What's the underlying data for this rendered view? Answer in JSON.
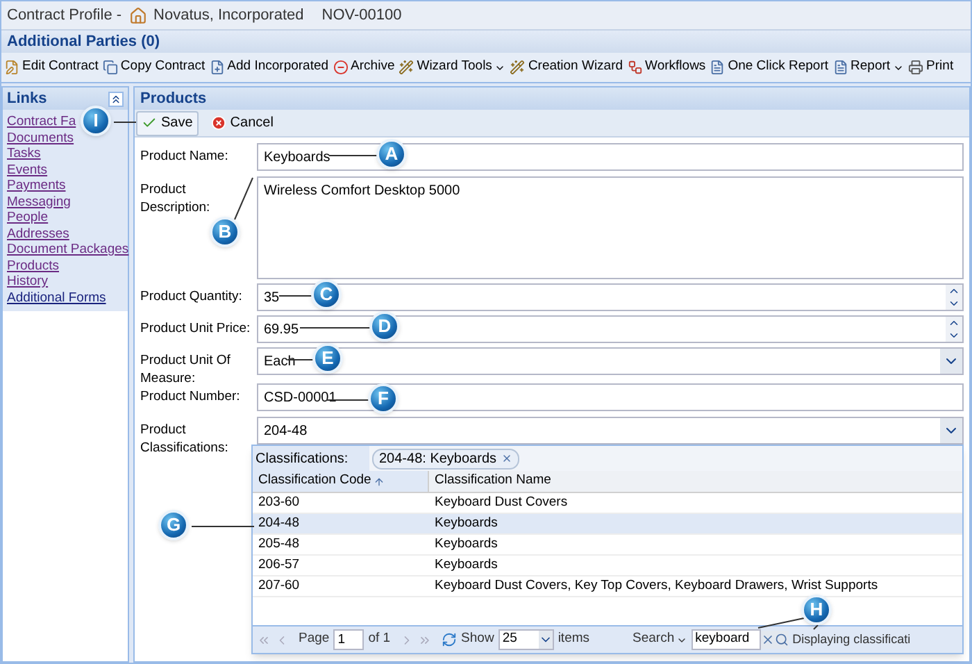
{
  "header": {
    "prefix": "Contract Profile -",
    "company": "Novatus, Incorporated",
    "contract_id": "NOV-00100"
  },
  "additional_parties": "Additional Parties (0)",
  "toolbar": [
    {
      "label": "Edit Contract",
      "kind": "edit",
      "menu": false
    },
    {
      "label": "Copy Contract",
      "kind": "copy",
      "menu": false
    },
    {
      "label": "Add Incorporated",
      "kind": "add",
      "menu": false
    },
    {
      "label": "Archive",
      "kind": "archive",
      "menu": false
    },
    {
      "label": "Wizard Tools",
      "kind": "wand",
      "menu": true
    },
    {
      "label": "Creation Wizard",
      "kind": "wand",
      "menu": false
    },
    {
      "label": "Workflows",
      "kind": "workflow",
      "menu": false
    },
    {
      "label": "One Click Report",
      "kind": "report",
      "menu": false
    },
    {
      "label": "Report",
      "kind": "report",
      "menu": true
    },
    {
      "label": "Print",
      "kind": "print",
      "menu": false
    }
  ],
  "sidebar": {
    "title": "Links",
    "items": [
      {
        "label": "Contract Fa",
        "visited": true
      },
      {
        "label": "Documents",
        "visited": true
      },
      {
        "label": "Tasks",
        "visited": true
      },
      {
        "label": "Events",
        "visited": true
      },
      {
        "label": "Payments",
        "visited": true
      },
      {
        "label": "Messaging",
        "visited": true
      },
      {
        "label": "People",
        "visited": true
      },
      {
        "label": "Addresses",
        "visited": true
      },
      {
        "label": "Document Packages",
        "visited": true
      },
      {
        "label": "Products",
        "visited": true
      },
      {
        "label": "History",
        "visited": true
      },
      {
        "label": "Additional Forms",
        "visited": false
      }
    ]
  },
  "panel": {
    "title": "Products",
    "actions": [
      {
        "label": "Save",
        "kind": "save"
      },
      {
        "label": "Cancel",
        "kind": "cancel"
      }
    ]
  },
  "fields": [
    {
      "label": "Product Name:",
      "kind": "text",
      "value": "Keyboards"
    },
    {
      "label": "Product Description:",
      "kind": "textarea",
      "value": "Wireless Comfort Desktop 5000"
    },
    {
      "label": "Product Quantity:",
      "kind": "spinner",
      "value": "35"
    },
    {
      "label": "Product Unit Price:",
      "kind": "spinner",
      "value": "69.95"
    },
    {
      "label": "Product Unit Of Measure:",
      "kind": "select",
      "value": "Each"
    },
    {
      "label": "Product Number:",
      "kind": "text",
      "value": "CSD-00001"
    },
    {
      "label": "Product Classifications:",
      "kind": "combo",
      "value": "204-48"
    }
  ],
  "classifications": {
    "label": "Classifications:",
    "chips": [
      "204-48: Keyboards"
    ],
    "columns": [
      "Classification Code",
      "Classification Name"
    ],
    "rows": [
      {
        "code": "203-60",
        "name": "Keyboard Dust Covers",
        "selected": false
      },
      {
        "code": "204-48",
        "name": "Keyboards",
        "selected": true
      },
      {
        "code": "205-48",
        "name": "Keyboards",
        "selected": false
      },
      {
        "code": "206-57",
        "name": "Keyboards",
        "selected": false
      },
      {
        "code": "207-60",
        "name": "Keyboard Dust Covers, Key Top Covers, Keyboard Drawers, Wrist Supports",
        "selected": false
      }
    ],
    "paging": {
      "page_label": "Page",
      "page": "1",
      "of": "of 1",
      "show_label": "Show",
      "page_size": "25",
      "items_label": "items",
      "search_label": "Search",
      "search_value": "keyboard",
      "status": "Displaying classificati"
    }
  },
  "callouts": [
    {
      "label": "A"
    },
    {
      "label": "B"
    },
    {
      "label": "C"
    },
    {
      "label": "D"
    },
    {
      "label": "E"
    },
    {
      "label": "F"
    },
    {
      "label": "G"
    },
    {
      "label": "H"
    },
    {
      "label": "I"
    }
  ]
}
